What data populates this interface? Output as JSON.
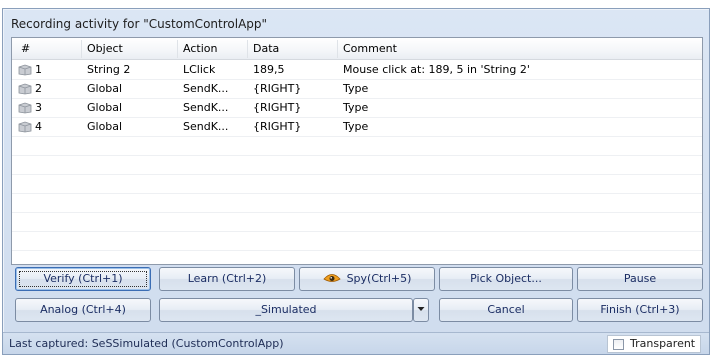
{
  "window": {
    "title": "Recording activity for \"CustomControlApp\""
  },
  "grid": {
    "columns": [
      "#",
      "Object",
      "Action",
      "Data",
      "Comment"
    ],
    "rows": [
      {
        "num": "1",
        "object": "String 2",
        "action": "LClick",
        "data": "189,5",
        "comment": "Mouse click at: 189, 5 in 'String 2'"
      },
      {
        "num": "2",
        "object": "Global",
        "action": "SendK...",
        "data": "{RIGHT}",
        "comment": "Type"
      },
      {
        "num": "3",
        "object": "Global",
        "action": "SendK...",
        "data": "{RIGHT}",
        "comment": "Type"
      },
      {
        "num": "4",
        "object": "Global",
        "action": "SendK...",
        "data": "{RIGHT}",
        "comment": "Type"
      }
    ],
    "row_icon": "recording-step-icon"
  },
  "buttons": {
    "verify": "Verify (Ctrl+1)",
    "learn": "Learn (Ctrl+2)",
    "spy": "Spy(Ctrl+5)",
    "spy_icon": "spy-eye-icon",
    "pick_object": "Pick Object...",
    "pause": "Pause",
    "analog": "Analog (Ctrl+4)",
    "simulated": "_Simulated",
    "dropdown_icon": "chevron-down-icon",
    "cancel": "Cancel",
    "finish": "Finish (Ctrl+3)"
  },
  "status": {
    "last_captured": "Last captured: SeSSimulated (CustomControlApp)",
    "transparent_label": "Transparent",
    "transparent_checked": false
  }
}
